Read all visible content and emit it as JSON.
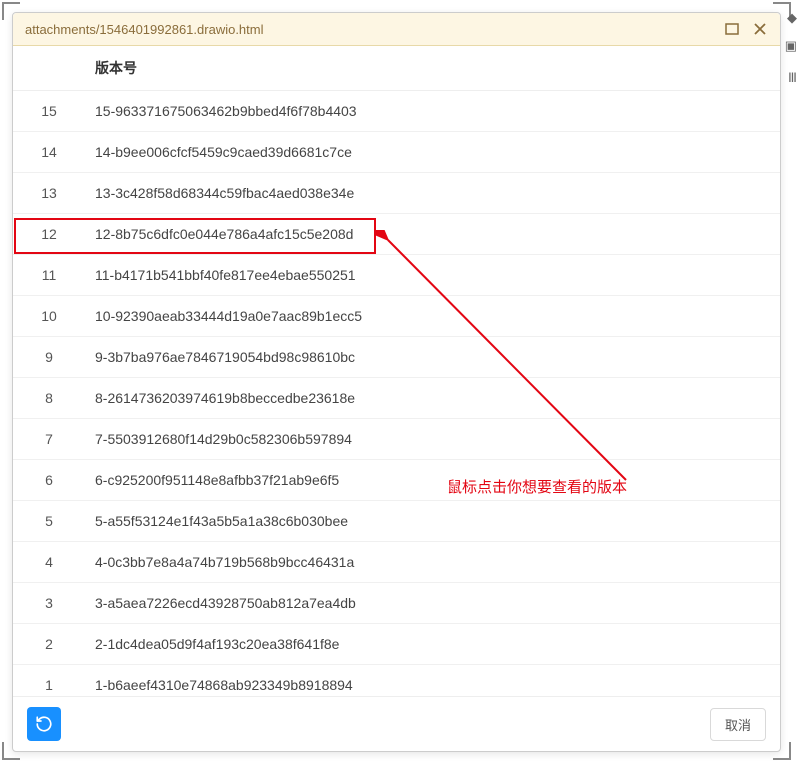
{
  "dialog": {
    "title": "attachments/1546401992861.drawio.html"
  },
  "table": {
    "columns": {
      "number": "",
      "version": "版本号"
    },
    "rows": [
      {
        "num": "15",
        "ver": "15-963371675063462b9bbed4f6f78b4403"
      },
      {
        "num": "14",
        "ver": "14-b9ee006cfcf5459c9caed39d6681c7ce"
      },
      {
        "num": "13",
        "ver": "13-3c428f58d68344c59fbac4aed038e34e"
      },
      {
        "num": "12",
        "ver": "12-8b75c6dfc0e044e786a4afc15c5e208d"
      },
      {
        "num": "11",
        "ver": "11-b4171b541bbf40fe817ee4ebae550251"
      },
      {
        "num": "10",
        "ver": "10-92390aeab33444d19a0e7aac89b1ecc5"
      },
      {
        "num": "9",
        "ver": "9-3b7ba976ae7846719054bd98c98610bc"
      },
      {
        "num": "8",
        "ver": "8-2614736203974619b8beccedbe23618e"
      },
      {
        "num": "7",
        "ver": "7-5503912680f14d29b0c582306b597894"
      },
      {
        "num": "6",
        "ver": "6-c925200f951148e8afbb37f21ab9e6f5"
      },
      {
        "num": "5",
        "ver": "5-a55f53124e1f43a5b5a1a38c6b030bee"
      },
      {
        "num": "4",
        "ver": "4-0c3bb7e8a4a74b719b568b9bcc46431a"
      },
      {
        "num": "3",
        "ver": "3-a5aea7226ecd43928750ab812a7ea4db"
      },
      {
        "num": "2",
        "ver": "2-1dc4dea05d9f4af193c20ea38f641f8e"
      },
      {
        "num": "1",
        "ver": "1-b6aeef4310e74868ab923349b8918894"
      }
    ]
  },
  "footer": {
    "cancel": "取消"
  },
  "annotation": {
    "text": "鼠标点击你想要查看的版本"
  }
}
